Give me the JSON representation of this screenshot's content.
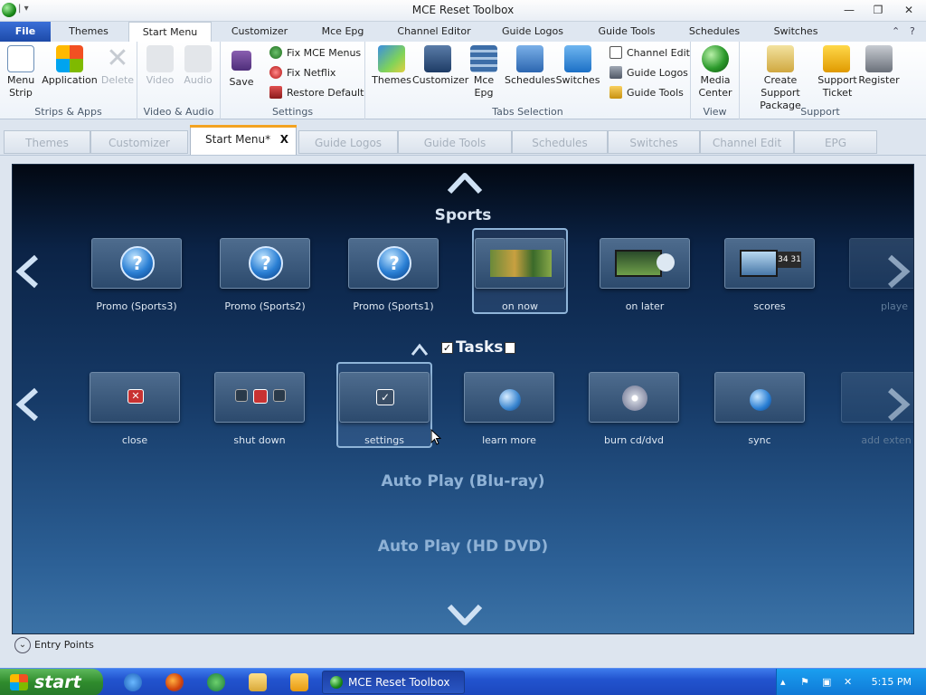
{
  "window": {
    "title": "MCE Reset Toolbox",
    "quick_access": "▾"
  },
  "ribbon_tabs": [
    "File",
    "Themes",
    "Start Menu",
    "Customizer",
    "Mce Epg",
    "Channel Editor",
    "Guide Logos",
    "Guide Tools",
    "Schedules",
    "Switches"
  ],
  "ribbon": {
    "strips_apps": {
      "label": "Strips & Apps",
      "menu_strip": "Menu Strip",
      "application": "Application",
      "delete": "Delete"
    },
    "video_audio": {
      "label": "Video & Audio",
      "video": "Video",
      "audio": "Audio"
    },
    "settings": {
      "label": "Settings",
      "save": "Save",
      "fix_mce_menus": "Fix MCE Menus",
      "fix_netflix": "Fix Netflix",
      "restore_default": "Restore Default"
    },
    "tabs_selection": {
      "label": "Tabs Selection",
      "themes": "Themes",
      "customizer": "Customizer",
      "mce_epg": "Mce Epg",
      "schedules": "Schedules",
      "switches": "Switches",
      "channel_edit": "Channel Edit",
      "guide_logos": "Guide Logos",
      "guide_tools": "Guide Tools"
    },
    "view": {
      "label": "View",
      "media_center": "Media Center"
    },
    "support": {
      "label": "Support",
      "create_support_package": "Create Support Package",
      "support_ticket": "Support Ticket",
      "register": "Register"
    }
  },
  "doc_tabs": [
    "Themes",
    "Customizer",
    "Start Menu*",
    "Guide Logos",
    "Guide Tools",
    "Schedules",
    "Switches",
    "Channel Edit",
    "EPG"
  ],
  "doc_tab_close": "X",
  "stage": {
    "sports_title": "Sports",
    "sports_items": [
      "Promo (Sports3)",
      "Promo (Sports2)",
      "Promo (Sports1)",
      "on now",
      "on later",
      "scores",
      "playe"
    ],
    "tasks_title": "Tasks",
    "tasks_items": [
      "close",
      "shut down",
      "settings",
      "learn more",
      "burn cd/dvd",
      "sync",
      "add exten"
    ],
    "autoplay_bluray": "Auto Play (Blu-ray)",
    "autoplay_hddvd": "Auto Play (HD DVD)"
  },
  "entry_points": "Entry Points",
  "taskbar": {
    "start": "start",
    "task": "MCE Reset Toolbox",
    "clock": "5:15 PM"
  }
}
